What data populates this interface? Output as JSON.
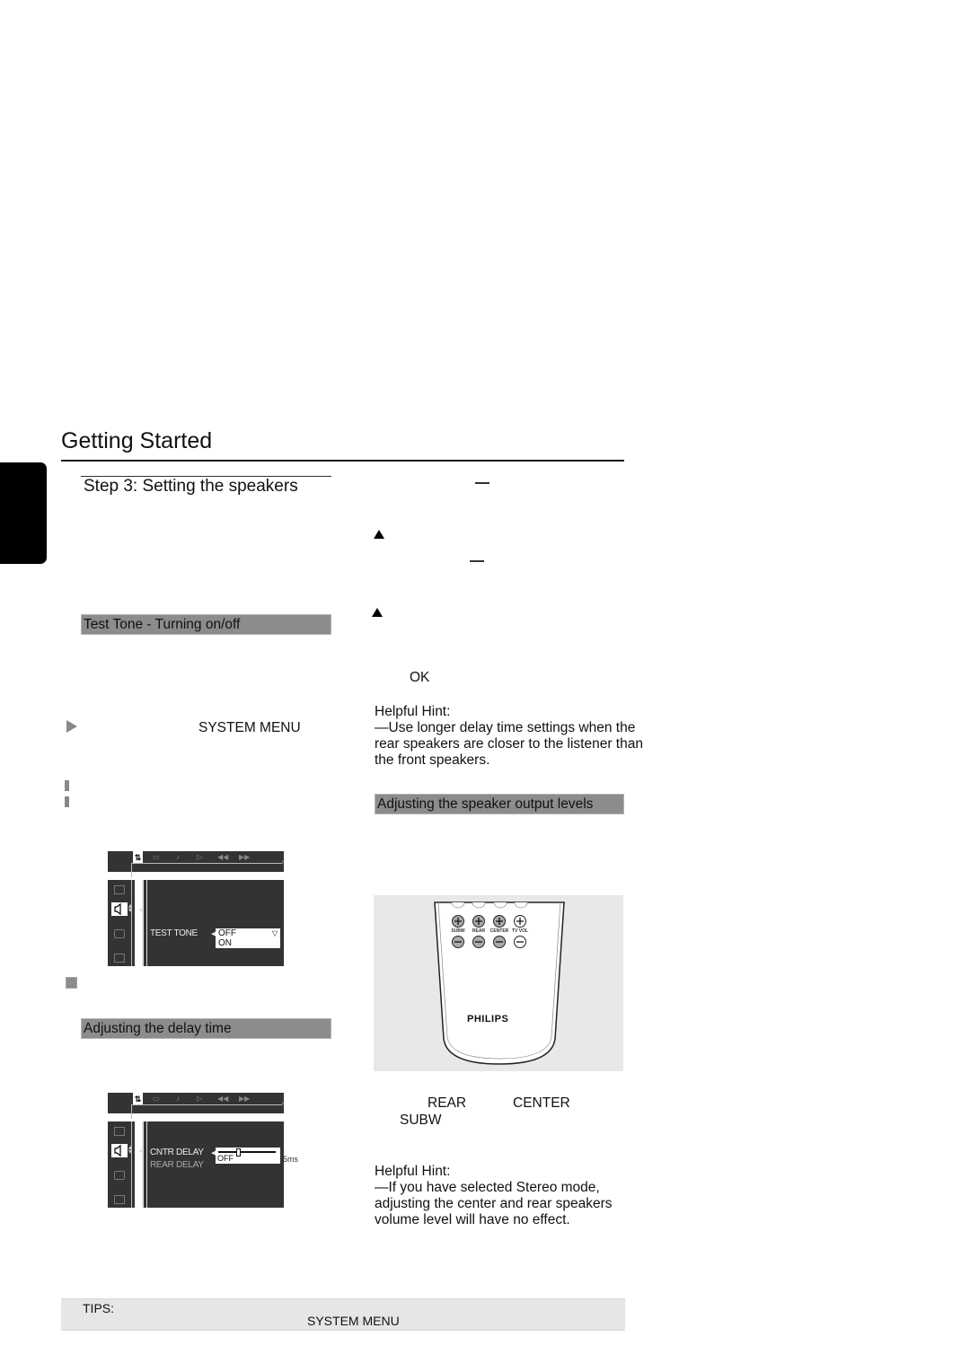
{
  "header": {
    "page_title": "Getting Started",
    "step_title": "Step 3:  Setting the speakers"
  },
  "left_column": {
    "test_tone_section": {
      "heading": "Test Tone - Turning on/off",
      "instruction_key": "SYSTEM MENU",
      "icons": [
        "play-icon",
        "pause-icon",
        "stop-icon"
      ]
    },
    "osd_test_tone": {
      "top_icons": [
        "setup-icon",
        "display-icon",
        "audio-icon",
        "play-icon",
        "rewind-icon",
        "forward-icon"
      ],
      "selected_top_icon": "setup",
      "side_icons": [
        "picture-icon",
        "speaker-icon",
        "subtitle-icon",
        "lock-icon"
      ],
      "selected_side_icon": "speaker",
      "menu_label": "TEST TONE",
      "options": [
        "OFF",
        "ON"
      ],
      "selected_option": "OFF"
    },
    "delay_section": {
      "heading": "Adjusting the delay time"
    },
    "osd_delay": {
      "menu_labels": [
        "CNTR DELAY",
        "REAR DELAY"
      ],
      "active_label": "CNTR DELAY",
      "slider_value_label": "OFF",
      "slider_max_label": "5ms",
      "slider_fraction": 0.35
    }
  },
  "right_column": {
    "ok_key": "OK",
    "hint1": {
      "title": "Helpful Hint:",
      "lines": [
        "—Use longer delay time settings when the",
        "rear speakers are closer to the listener than",
        "the front speakers."
      ]
    },
    "speaker_levels_section": {
      "heading": "Adjusting the speaker output levels"
    },
    "remote": {
      "button_labels": [
        "SUBW",
        "REAR",
        "CENTER",
        "TV VOL"
      ],
      "brand": "PHILIPS"
    },
    "keys_line1": [
      "REAR",
      "CENTER"
    ],
    "keys_line2": "SUBW",
    "hint2": {
      "title": "Helpful Hint:",
      "lines": [
        "—If you have selected Stereo mode,",
        "adjusting the center and rear speakers",
        "volume level will have no effect."
      ]
    }
  },
  "footer": {
    "tips_label": "TIPS:",
    "tips_key": "SYSTEM MENU"
  }
}
